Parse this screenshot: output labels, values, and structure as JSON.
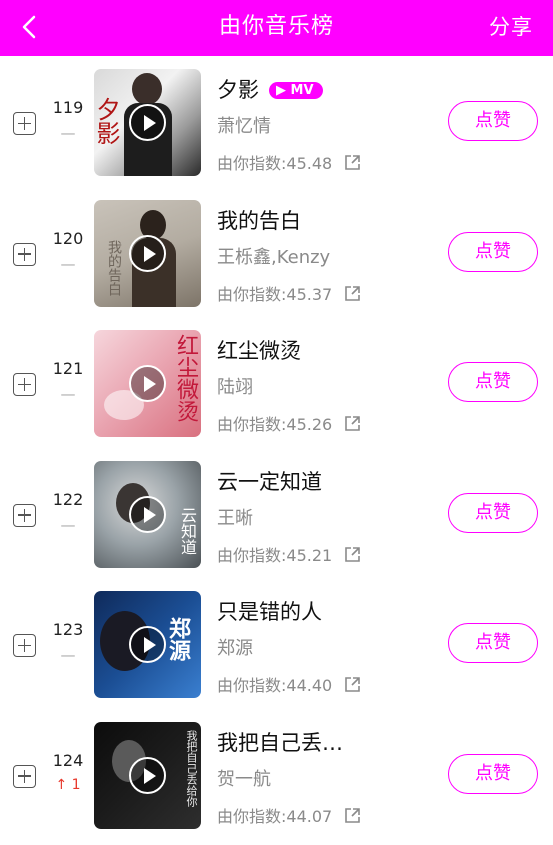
{
  "header": {
    "title": "由你音乐榜",
    "share_label": "分享",
    "bg_color": "#ff00ff"
  },
  "songs": [
    {
      "rank": "119",
      "trend": "—",
      "trend_type": "same",
      "title": "夕影",
      "mv_badge": "MV",
      "artist": "萧忆情",
      "index": "由你指数:45.48",
      "like_label": "点赞",
      "cover_text": "夕影"
    },
    {
      "rank": "120",
      "trend": "—",
      "trend_type": "same",
      "title": "我的告白",
      "artist": "王栎鑫,Kenzy",
      "index": "由你指数:45.37",
      "like_label": "点赞",
      "cover_text": "我的告白"
    },
    {
      "rank": "121",
      "trend": "—",
      "trend_type": "same",
      "title": "红尘微烫",
      "artist": "陆翊",
      "index": "由你指数:45.26",
      "like_label": "点赞",
      "cover_text": "红尘微烫"
    },
    {
      "rank": "122",
      "trend": "—",
      "trend_type": "same",
      "title": "云一定知道",
      "artist": "王晰",
      "index": "由你指数:45.21",
      "like_label": "点赞",
      "cover_text": "云知道"
    },
    {
      "rank": "123",
      "trend": "—",
      "trend_type": "same",
      "title": "只是错的人",
      "artist": "郑源",
      "index": "由你指数:44.40",
      "like_label": "点赞",
      "cover_text": "郑源"
    },
    {
      "rank": "124",
      "trend": "↑ 1",
      "trend_type": "up",
      "title": "我把自己丢…",
      "artist": "贺一航",
      "index": "由你指数:44.07",
      "like_label": "点赞",
      "cover_text": "我把自己丢给你"
    }
  ]
}
